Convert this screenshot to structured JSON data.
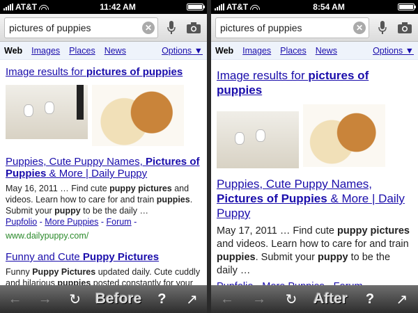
{
  "panels": [
    {
      "id": "left",
      "status": {
        "carrier": "AT&T",
        "time": "11:42 AM"
      },
      "search": {
        "query": "pictures of puppies",
        "clear_label": "✕"
      },
      "tabs": {
        "web": "Web",
        "images": "Images",
        "places": "Places",
        "news": "News",
        "options": "Options ▼"
      },
      "image_results": {
        "prefix": "Image results for ",
        "query": "pictures of puppies"
      },
      "result1": {
        "title_a": "Puppies, Cute Puppy Names, ",
        "title_b": "Pictures of Puppies",
        "title_c": " & More | Daily Puppy",
        "date": "May 16, 2011 … Find cute ",
        "s1": "puppy pictures",
        "s2": " and videos. Learn how to care for and train ",
        "s3": "puppies",
        "s4": ". Submit your ",
        "s5": "puppy",
        "s6": " to be the daily …",
        "link1": "Pupfolio",
        "link2": "More Puppies",
        "link3": "Forum",
        "sep": " - ",
        "cite": "www.dailypuppy.com/"
      },
      "result2": {
        "title_a": "Funny and Cute ",
        "title_b": "Puppy Pictures",
        "s1": "Funny ",
        "s2": "Puppy Pictures",
        "s3": " updated daily. Cute cuddly and hilarious ",
        "s4": "puppies",
        "s5": " posted constantly for your"
      },
      "toolbar_label": "Before"
    },
    {
      "id": "right",
      "status": {
        "carrier": "AT&T",
        "time": "8:54 AM"
      },
      "search": {
        "query": "pictures of puppies",
        "clear_label": "✕"
      },
      "tabs": {
        "web": "Web",
        "images": "Images",
        "places": "Places",
        "news": "News",
        "options": "Options ▼"
      },
      "image_results": {
        "prefix": "Image results for ",
        "query": "pictures of puppies"
      },
      "result1": {
        "title_a": "Puppies, Cute Puppy Names, ",
        "title_b": "Pictures of Puppies",
        "title_c": " & More | Daily Puppy",
        "date": "May 17, 2011 … Find cute ",
        "s1": "puppy pictures",
        "s2": " and videos. Learn how to care for and train ",
        "s3": "puppies",
        "s4": ". Submit your ",
        "s5": "puppy",
        "s6": " to be the daily …",
        "link1": "Pupfolio",
        "link2": "More Puppies",
        "link3": "Forum",
        "sep": " - "
      },
      "toolbar_label": "After"
    }
  ],
  "toolbar": {
    "back": "←",
    "forward": "→",
    "reload": "↻",
    "help": "?",
    "share": "↗"
  },
  "colors": {
    "link": "#1a0dab",
    "cite": "#2b8a2b",
    "toolbar": "#3a3a3a"
  }
}
